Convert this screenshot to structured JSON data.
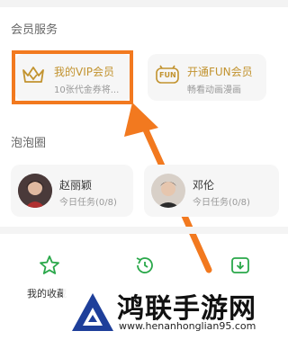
{
  "member_services": {
    "title": "会员服务",
    "vip_card": {
      "title": "我的VIP会员",
      "subtitle": "10张代金券将..."
    },
    "fun_card": {
      "title": "开通FUN会员",
      "subtitle": "畅看动画漫画",
      "icon_text": "FUN"
    }
  },
  "bubble_circle": {
    "title": "泡泡圈",
    "people": [
      {
        "name": "赵丽颖",
        "task": "今日任务(0/8)"
      },
      {
        "name": "邓伦",
        "task": "今日任务(0/8)"
      }
    ]
  },
  "grid": {
    "favorites_label": "我的收藏"
  },
  "watermark": {
    "title": "鸿联手游网",
    "url": "www.henanhonglian95.com"
  },
  "colors": {
    "highlight": "#f2791f",
    "gold": "#c2932f",
    "green": "#2aa84a"
  }
}
